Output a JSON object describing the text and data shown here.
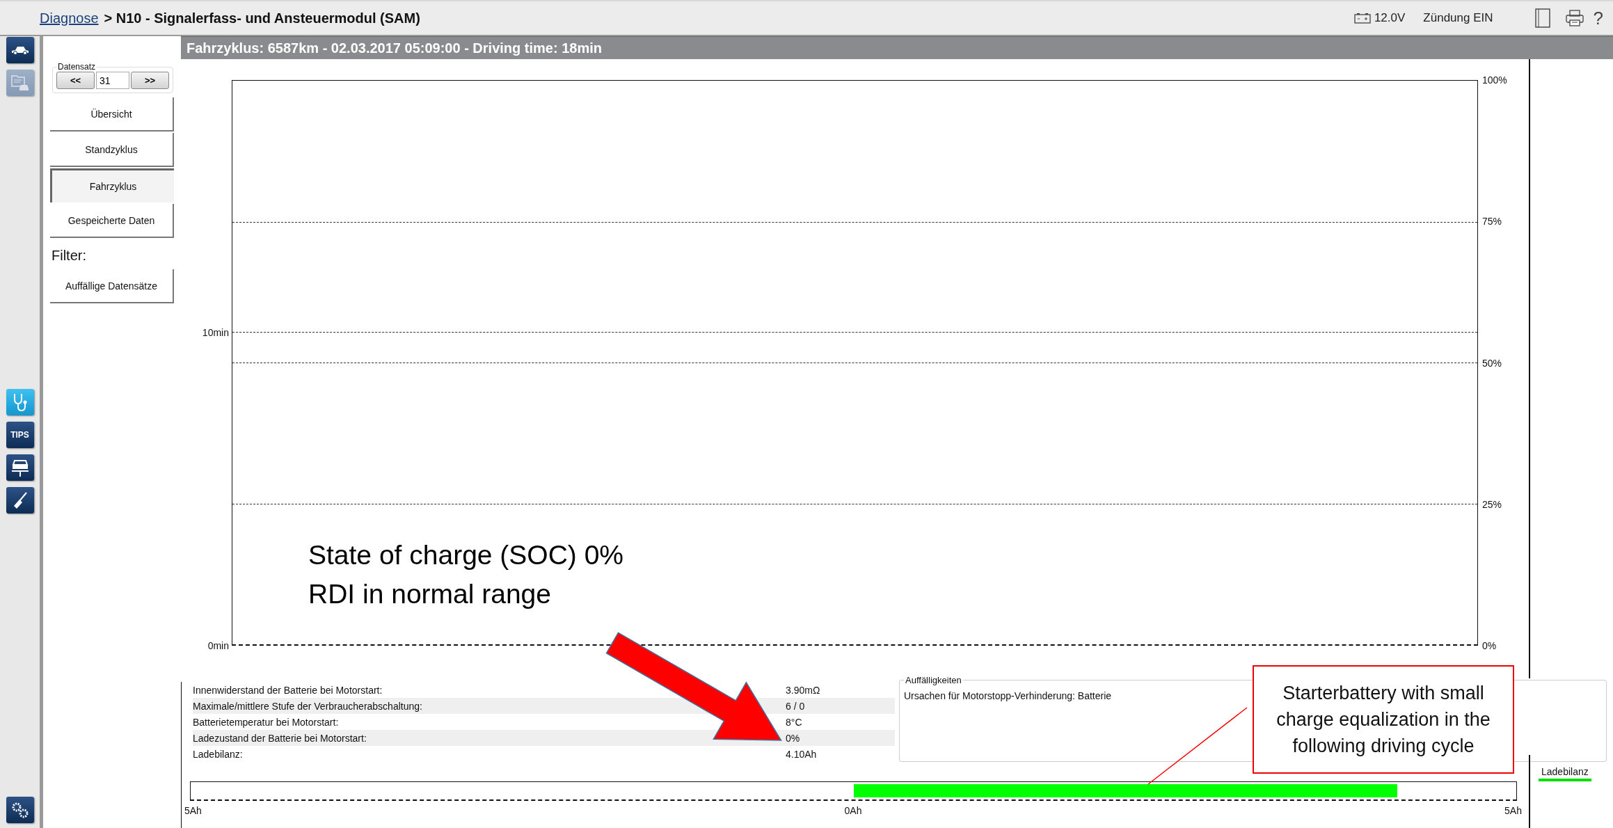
{
  "breadcrumb": {
    "link": "Diagnose",
    "rest": "> N10 - Signalerfass- und Ansteuermodul (SAM)"
  },
  "status": {
    "voltage": "12.0V",
    "ignition": "Zündung EIN",
    "help": "?"
  },
  "top_icons": [
    {
      "kind": "car",
      "disabled": false
    },
    {
      "kind": "records",
      "disabled": true
    }
  ],
  "tool_icons": [
    {
      "kind": "stethoscope",
      "selected": true
    },
    {
      "kind": "tips",
      "label": "TIPS",
      "selected": false
    },
    {
      "kind": "lift",
      "selected": false
    },
    {
      "kind": "tool",
      "selected": false
    }
  ],
  "datensatz": {
    "legend": "Datensatz",
    "prev": "<<",
    "value": "31",
    "next": ">>"
  },
  "nav": [
    {
      "label": "Übersicht",
      "selected": false
    },
    {
      "label": "Standzyklus",
      "selected": false
    },
    {
      "label": "Fahrzyklus",
      "selected": true
    },
    {
      "label": "Gespeicherte Daten",
      "selected": false
    }
  ],
  "filter": {
    "label": "Filter:",
    "items": [
      {
        "label": "Auffällige Datensätze",
        "selected": false
      }
    ]
  },
  "header": "Fahrzyklus: 6587km - 02.03.2017 05:09:00 - Driving time: 18min",
  "chart": {
    "left_ticks": [
      "10min",
      "0min"
    ],
    "right_ticks": [
      "100%",
      "75%",
      "50%",
      "25%",
      "0%"
    ]
  },
  "annotation": [
    "State of charge (SOC) 0%",
    "RDI in normal range"
  ],
  "details": [
    {
      "label": "Innenwiderstand der Batterie bei Motorstart:",
      "value": "3.90mΩ"
    },
    {
      "label": "Maximale/mittlere Stufe der Verbraucherabschaltung:",
      "value": "6 / 0"
    },
    {
      "label": "Batterietemperatur bei Motorstart:",
      "value": "8°C"
    },
    {
      "label": "Ladezustand der Batterie bei Motorstart:",
      "value": "0%"
    },
    {
      "label": "Ladebilanz:",
      "value": "4.10Ah"
    }
  ],
  "auffaelligkeiten": {
    "legend": "Auffälligkeiten",
    "text": "Ursachen für Motorstopp-Verhinderung: Batterie"
  },
  "callout": "Starterbattery with small charge equalization in the following driving cycle",
  "balance": {
    "level": 0.82,
    "labels": [
      "5Ah",
      "0Ah",
      "5Ah"
    ],
    "legend": "Ladebilanz"
  }
}
